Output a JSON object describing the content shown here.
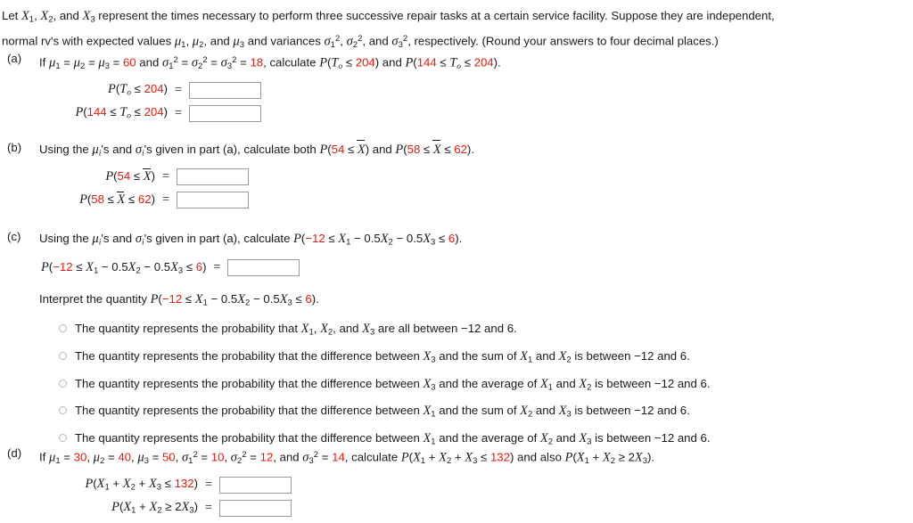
{
  "problem": {
    "intro_line1": "Let X₁, X₂, and X₃ represent the times necessary to perform three successive repair tasks at a certain service facility. Suppose they are independent,",
    "intro_line2": "normal rv's with expected values μ₁, μ₂, and μ₃ and variances σ₁², σ₂², and σ₃², respectively. (Round your answers to four decimal places.)",
    "accent_color": "#e8180c",
    "text_color": "#1a1a1a"
  },
  "parts": {
    "a": {
      "label": "(a)",
      "stem_prefix": "If ",
      "mu_values": "60",
      "sigma_values": "18",
      "stem_mid": " and ",
      "stem_calc": ", calculate ",
      "target1": "204",
      "target2_lo": "144",
      "target2_hi": "204",
      "rows": [
        {
          "label_plain": "P(T_o ≤ 204) =",
          "value": "",
          "numbers": [
            "204"
          ]
        },
        {
          "label_plain": "P(144 ≤ T_o ≤ 204) =",
          "value": "",
          "numbers": [
            "144",
            "204"
          ]
        }
      ]
    },
    "b": {
      "label": "(b)",
      "stem": "Using the μᵢ's and σᵢ's given in part (a), calculate both P(54 ≤ X̄) and P(58 ≤ X̄ ≤ 62).",
      "v1": "54",
      "v2_lo": "58",
      "v2_hi": "62",
      "rows": [
        {
          "label_plain": "P(54 ≤ X̄) =",
          "value": ""
        },
        {
          "label_plain": "P(58 ≤ X̄ ≤ 62) =",
          "value": ""
        }
      ]
    },
    "c": {
      "label": "(c)",
      "stem": "Using the μᵢ's and σᵢ's given in part (a), calculate P(−12 ≤ X₁ − 0.5X₂ − 0.5X₃ ≤ 6).",
      "lo": "−12",
      "hi": "6",
      "coef": "0.5",
      "answer_label": "P(−12 ≤ X₁ − 0.5X₂ − 0.5X₃ ≤ 6) =",
      "answer_value": "",
      "interpret_prompt": "Interpret the quantity P(−12 ≤ X₁ − 0.5X₂ − 0.5X₃ ≤ 6).",
      "options": [
        {
          "id": "opt-1",
          "text": "The quantity represents the probability that X₁, X₂, and X₃ are all between −12 and 6.",
          "selected": false
        },
        {
          "id": "opt-2",
          "text": "The quantity represents the probability that the difference between X₃ and the sum of X₁ and X₂ is between −12 and 6.",
          "selected": false
        },
        {
          "id": "opt-3",
          "text": "The quantity represents the probability that the difference between X₃ and the average of X₁ and X₂ is between −12 and 6.",
          "selected": false
        },
        {
          "id": "opt-4",
          "text": "The quantity represents the probability that the difference between X₁ and the sum of X₂ and X₃ is between −12 and 6.",
          "selected": false
        },
        {
          "id": "opt-5",
          "text": "The quantity represents the probability that the difference between X₁ and the average of X₂ and X₃ is between −12 and 6.",
          "selected": false
        }
      ]
    },
    "d": {
      "label": "(d)",
      "mu1": "30",
      "mu2": "40",
      "mu3": "50",
      "sig1": "10",
      "sig2": "12",
      "sig3": "14",
      "target1": "132",
      "stem_plain": "If μ₁ = 30, μ₂ = 40, μ₃ = 50, σ₁² = 10, σ₂² = 12, and σ₃² = 14, calculate P(X₁ + X₂ + X₃ ≤ 132) and also P(X₁ + X₂ ≥ 2X₃).",
      "rows": [
        {
          "label_plain": "P(X₁ + X₂ + X₃ ≤ 132) =",
          "value": ""
        },
        {
          "label_plain": "P(X₁ + X₂ ≥ 2X₃) =",
          "value": ""
        }
      ]
    }
  },
  "symbols": {
    "mu": "μ",
    "sigma": "σ",
    "le": "≤",
    "ge": "≥",
    "minus": "−",
    "xbar": "X̄"
  }
}
